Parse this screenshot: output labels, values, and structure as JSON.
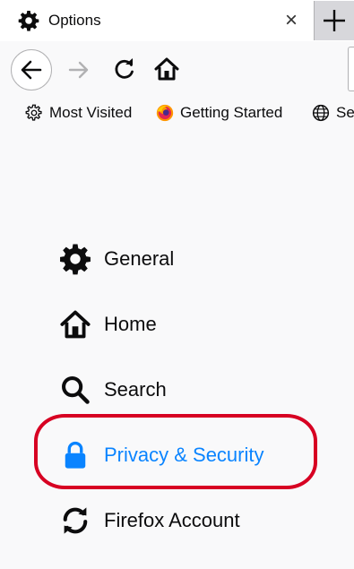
{
  "tab": {
    "title": "Options",
    "favicon": "gear-icon",
    "close_symbol": "×",
    "new_tab_symbol": "+"
  },
  "navbar": {
    "back_icon": "back-arrow-icon",
    "forward_icon": "forward-arrow-icon",
    "reload_icon": "reload-icon",
    "home_icon": "home-icon"
  },
  "bookmarks": [
    {
      "label": "Most Visited",
      "icon": "gear-icon"
    },
    {
      "label": "Getting Started",
      "icon": "firefox-logo-icon"
    },
    {
      "label": "Se",
      "icon": "globe-icon"
    }
  ],
  "categories": [
    {
      "label": "General",
      "icon": "gear-icon",
      "selected": false
    },
    {
      "label": "Home",
      "icon": "home-icon",
      "selected": false
    },
    {
      "label": "Search",
      "icon": "search-icon",
      "selected": false
    },
    {
      "label": "Privacy & Security",
      "icon": "lock-icon",
      "selected": true
    },
    {
      "label": "Firefox Account",
      "icon": "sync-icon",
      "selected": false
    }
  ],
  "colors": {
    "selected": "#0a84ff",
    "highlight": "#d70022",
    "text": "#0c0c0d"
  }
}
